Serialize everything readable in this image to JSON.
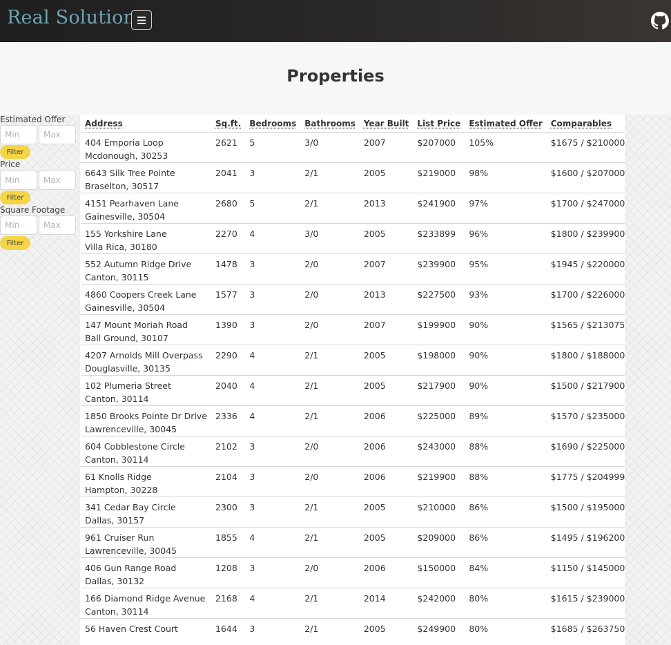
{
  "header": {
    "brand": "Real Solution",
    "menu_icon": "hamburger-icon",
    "github_icon": "github-icon",
    "brand_color": "#6fa3b6"
  },
  "page": {
    "title": "Properties"
  },
  "filters": [
    {
      "label": "Estimated Offer",
      "min_placeholder": "Min",
      "max_placeholder": "Max",
      "button": "Filter"
    },
    {
      "label": "Price",
      "min_placeholder": "Min",
      "max_placeholder": "Max",
      "button": "Filter"
    },
    {
      "label": "Square Footage",
      "min_placeholder": "Min",
      "max_placeholder": "Max",
      "button": "Filter"
    }
  ],
  "table": {
    "columns": [
      "Address",
      "Sq.ft.",
      "Bedrooms",
      "Bathrooms",
      "Year Built",
      "List Price",
      "Estimated Offer",
      "Comparables"
    ],
    "rows": [
      {
        "street": "404 Emporia Loop",
        "city": "Mcdonough, 30253",
        "sqft": "2621",
        "beds": "5",
        "baths": "3/0",
        "year": "2007",
        "price": "$207000",
        "offer": "105%",
        "comps": "$1675 / $210000"
      },
      {
        "street": "6643 Silk Tree Pointe",
        "city": "Braselton, 30517",
        "sqft": "2041",
        "beds": "3",
        "baths": "2/1",
        "year": "2005",
        "price": "$219000",
        "offer": "98%",
        "comps": "$1600 / $207000"
      },
      {
        "street": "4151 Pearhaven Lane",
        "city": "Gainesville, 30504",
        "sqft": "2680",
        "beds": "5",
        "baths": "2/1",
        "year": "2013",
        "price": "$241900",
        "offer": "97%",
        "comps": "$1700 / $247000"
      },
      {
        "street": "155 Yorkshire Lane",
        "city": "Villa Rica, 30180",
        "sqft": "2270",
        "beds": "4",
        "baths": "3/0",
        "year": "2005",
        "price": "$233899",
        "offer": "96%",
        "comps": "$1800 / $239900"
      },
      {
        "street": "552 Autumn Ridge Drive",
        "city": "Canton, 30115",
        "sqft": "1478",
        "beds": "3",
        "baths": "2/0",
        "year": "2007",
        "price": "$239900",
        "offer": "95%",
        "comps": "$1945 / $220000"
      },
      {
        "street": "4860 Coopers Creek Lane",
        "city": "Gainesville, 30504",
        "sqft": "1577",
        "beds": "3",
        "baths": "2/0",
        "year": "2013",
        "price": "$227500",
        "offer": "93%",
        "comps": "$1700 / $226000"
      },
      {
        "street": "147 Mount Moriah Road",
        "city": "Ball Ground, 30107",
        "sqft": "1390",
        "beds": "3",
        "baths": "2/0",
        "year": "2007",
        "price": "$199900",
        "offer": "90%",
        "comps": "$1565 / $213075"
      },
      {
        "street": "4207 Arnolds Mill Overpass",
        "city": "Douglasville, 30135",
        "sqft": "2290",
        "beds": "4",
        "baths": "2/1",
        "year": "2005",
        "price": "$198000",
        "offer": "90%",
        "comps": "$1800 / $188000"
      },
      {
        "street": "102 Plumeria Street",
        "city": "Canton, 30114",
        "sqft": "2040",
        "beds": "4",
        "baths": "2/1",
        "year": "2005",
        "price": "$217900",
        "offer": "90%",
        "comps": "$1500 / $217900"
      },
      {
        "street": "1850 Brooks Pointe Dr Drive",
        "city": "Lawrenceville, 30045",
        "sqft": "2336",
        "beds": "4",
        "baths": "2/1",
        "year": "2006",
        "price": "$225000",
        "offer": "89%",
        "comps": "$1570 / $235000"
      },
      {
        "street": "604 Cobblestone Circle",
        "city": "Canton, 30114",
        "sqft": "2102",
        "beds": "3",
        "baths": "2/0",
        "year": "2006",
        "price": "$243000",
        "offer": "88%",
        "comps": "$1690 / $225000"
      },
      {
        "street": "61 Knolls Ridge",
        "city": "Hampton, 30228",
        "sqft": "2104",
        "beds": "3",
        "baths": "2/0",
        "year": "2006",
        "price": "$219900",
        "offer": "88%",
        "comps": "$1775 / $204999"
      },
      {
        "street": "341 Cedar Bay Circle",
        "city": "Dallas, 30157",
        "sqft": "2300",
        "beds": "3",
        "baths": "2/1",
        "year": "2005",
        "price": "$210000",
        "offer": "86%",
        "comps": "$1500 / $195000"
      },
      {
        "street": "961 Cruiser Run",
        "city": "Lawrenceville, 30045",
        "sqft": "1855",
        "beds": "4",
        "baths": "2/1",
        "year": "2005",
        "price": "$209000",
        "offer": "86%",
        "comps": "$1495 / $196200"
      },
      {
        "street": "406 Gun Range Road",
        "city": "Dallas, 30132",
        "sqft": "1208",
        "beds": "3",
        "baths": "2/0",
        "year": "2006",
        "price": "$150000",
        "offer": "84%",
        "comps": "$1150 / $145000"
      },
      {
        "street": "166 Diamond Ridge Avenue",
        "city": "Canton, 30114",
        "sqft": "2168",
        "beds": "4",
        "baths": "2/1",
        "year": "2014",
        "price": "$242000",
        "offer": "80%",
        "comps": "$1615 / $239000"
      },
      {
        "street": "56 Haven Crest Court",
        "city": "",
        "sqft": "1644",
        "beds": "3",
        "baths": "2/1",
        "year": "2005",
        "price": "$249900",
        "offer": "80%",
        "comps": "$1685 / $263750"
      }
    ]
  }
}
